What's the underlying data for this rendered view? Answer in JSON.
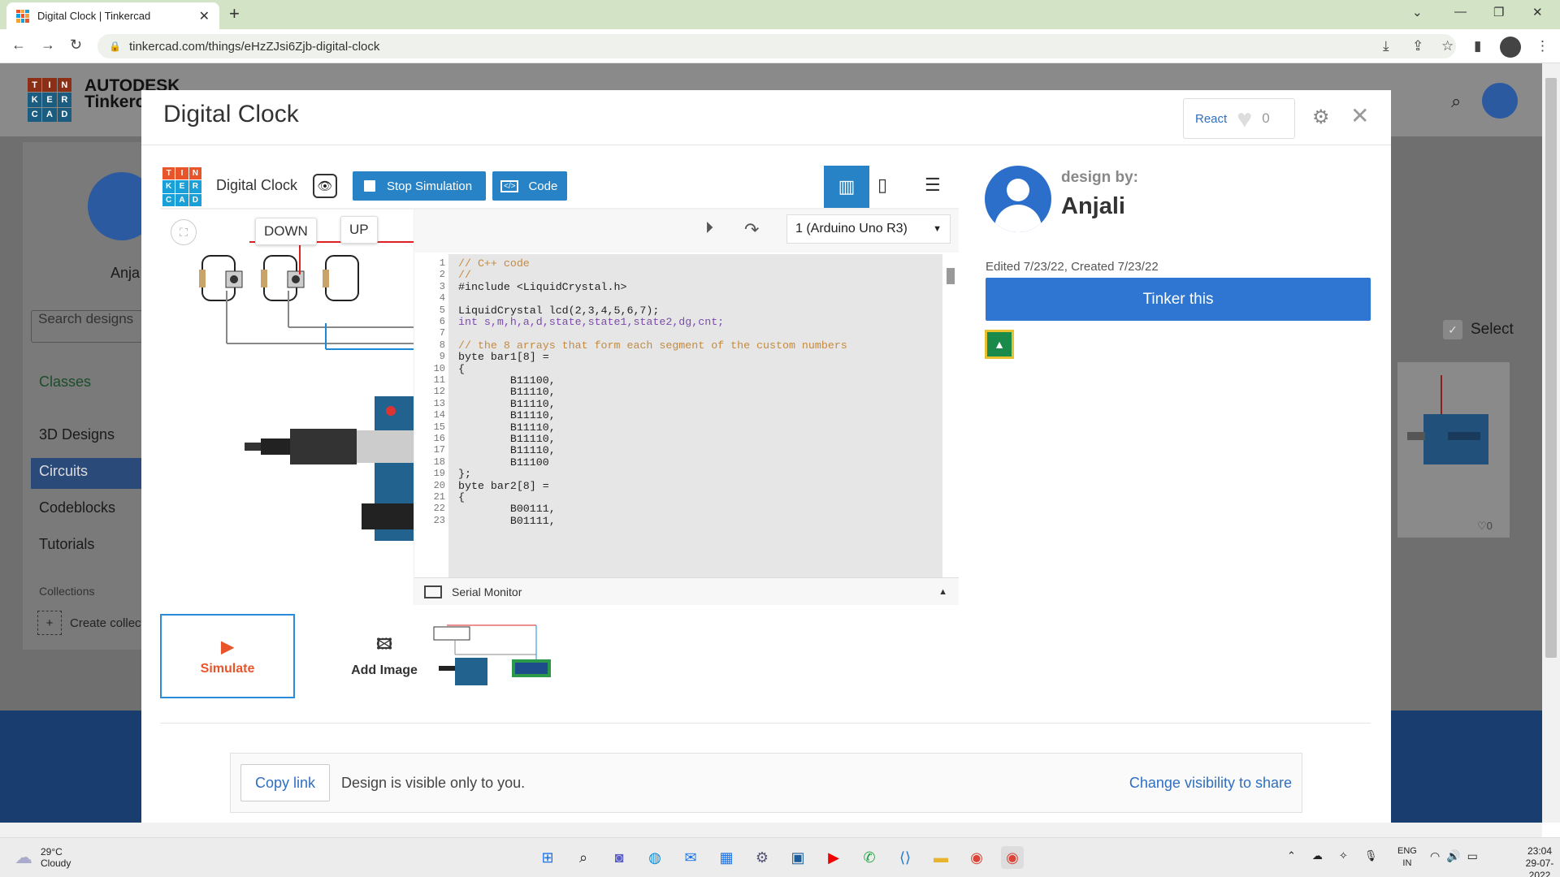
{
  "browser": {
    "tab_title": "Digital Clock | Tinkercad",
    "url": "tinkercad.com/things/eHzZJsi6Zjb-digital-clock",
    "new_tab": "+",
    "tab_close": "✕"
  },
  "background": {
    "brand_line1": "AUTODESK",
    "brand_line2": "Tinkercad",
    "user_short": "Anja",
    "search_placeholder": "Search designs",
    "nav": [
      "Classes",
      "3D Designs",
      "Circuits",
      "Codeblocks",
      "Tutorials"
    ],
    "collections_label": "Collections",
    "create_collection": "Create collection",
    "select_label": "Select",
    "card_likes": "0"
  },
  "modal": {
    "title": "Digital Clock",
    "react_label": "React",
    "react_count": "0"
  },
  "viewer": {
    "logo_letters": [
      "T",
      "I",
      "N",
      "K",
      "E",
      "R",
      "C",
      "A",
      "D"
    ],
    "title": "Digital Clock",
    "stop_simulation": "Stop Simulation",
    "code": "Code",
    "circuit_labels": {
      "down": "DOWN",
      "up": "UP"
    },
    "board_select": "1 (Arduino Uno R3)",
    "serial_monitor": "Serial Monitor",
    "code_lines": [
      {
        "n": "1",
        "t": "// C++ code",
        "c": "cm"
      },
      {
        "n": "2",
        "t": "//",
        "c": "cm"
      },
      {
        "n": "3",
        "t": "#include <LiquidCrystal.h>",
        "c": ""
      },
      {
        "n": "4",
        "t": "",
        "c": ""
      },
      {
        "n": "5",
        "t": "LiquidCrystal lcd(2,3,4,5,6,7);",
        "c": ""
      },
      {
        "n": "6",
        "t": "int s,m,h,a,d,state,state1,state2,dg,cnt;",
        "c": "kw"
      },
      {
        "n": "7",
        "t": "",
        "c": ""
      },
      {
        "n": "8",
        "t": "// the 8 arrays that form each segment of the custom numbers",
        "c": "cm"
      },
      {
        "n": "9",
        "t": "byte bar1[8] =",
        "c": ""
      },
      {
        "n": "10",
        "t": "{",
        "c": ""
      },
      {
        "n": "11",
        "t": "        B11100,",
        "c": ""
      },
      {
        "n": "12",
        "t": "        B11110,",
        "c": ""
      },
      {
        "n": "13",
        "t": "        B11110,",
        "c": ""
      },
      {
        "n": "14",
        "t": "        B11110,",
        "c": ""
      },
      {
        "n": "15",
        "t": "        B11110,",
        "c": ""
      },
      {
        "n": "16",
        "t": "        B11110,",
        "c": ""
      },
      {
        "n": "17",
        "t": "        B11110,",
        "c": ""
      },
      {
        "n": "18",
        "t": "        B11100",
        "c": ""
      },
      {
        "n": "19",
        "t": "};",
        "c": ""
      },
      {
        "n": "20",
        "t": "byte bar2[8] =",
        "c": ""
      },
      {
        "n": "21",
        "t": "{",
        "c": ""
      },
      {
        "n": "22",
        "t": "        B00111,",
        "c": ""
      },
      {
        "n": "23",
        "t": "        B01111,",
        "c": ""
      }
    ]
  },
  "bottom": {
    "simulate": "Simulate",
    "add_image": "Add Image",
    "copy_link": "Copy link",
    "visibility_text": "Design is visible only to you.",
    "change_visibility": "Change visibility to share"
  },
  "designer": {
    "design_by": "design by:",
    "name": "Anjali",
    "dates": "Edited 7/23/22, Created 7/23/22",
    "tinker_this": "Tinker this"
  },
  "taskbar": {
    "temp": "29°C",
    "weather": "Cloudy",
    "lang1": "ENG",
    "lang2": "IN",
    "time": "23:04",
    "date": "29-07-2022"
  }
}
